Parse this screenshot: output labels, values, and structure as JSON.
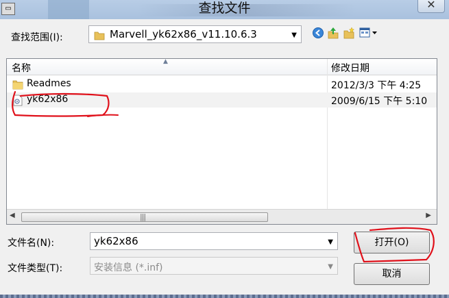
{
  "dialog": {
    "title": "查找文件",
    "close_glyph": "✕"
  },
  "lookin": {
    "label": "查找范围(I):",
    "value": "Marvell_yk62x86_v11.10.6.3"
  },
  "toolbar_icons": [
    "back-icon",
    "up-folder-icon",
    "new-folder-icon",
    "view-menu-icon"
  ],
  "list": {
    "columns": [
      "名称",
      "修改日期"
    ],
    "rows": [
      {
        "name": "Readmes",
        "date": "2012/3/3 下午 4:25",
        "icon": "folder-icon"
      },
      {
        "name": "yk62x86",
        "date": "2009/6/15 下午 5:10",
        "icon": "setup-info-file-icon"
      }
    ],
    "scroll_left": "◀",
    "scroll_right": "▶",
    "scroll_grip": "|||"
  },
  "filename": {
    "label": "文件名(N):",
    "value": "yk62x86"
  },
  "filetype": {
    "label": "文件类型(T):",
    "value": "安装信息 (*.inf)"
  },
  "buttons": {
    "open": "打开(O)",
    "cancel": "取消"
  },
  "colors": {
    "annotation_red": "#e0101a",
    "titlebar": "#b8cde6"
  }
}
